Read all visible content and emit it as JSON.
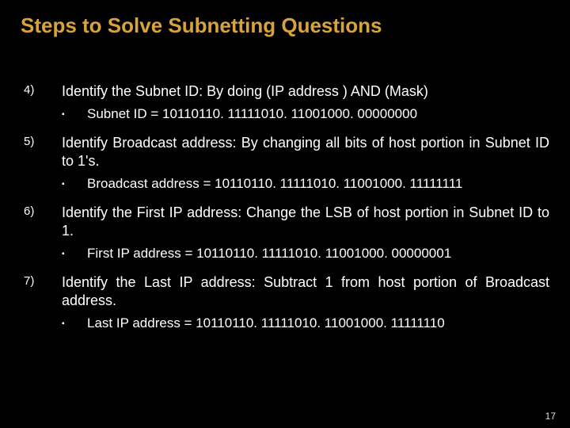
{
  "title": "Steps to Solve Subnetting Questions",
  "steps": [
    {
      "num": "4)",
      "text": "Identify the Subnet ID: By doing (IP address ) AND (Mask)",
      "sub_prefix": "Subnet ID",
      "sub_value": " = 10110110. 11111010. 11001000. 00000000"
    },
    {
      "num": "5)",
      "text": "Identify Broadcast address: By changing all bits of host portion in Subnet ID to 1's.",
      "sub_prefix": "Broadcast address ",
      "sub_value": " = 10110110. 11111010. 11001000. 11111111"
    },
    {
      "num": "6)",
      "text": "Identify the First IP address: Change the LSB of  host portion in Subnet ID to 1.",
      "sub_prefix": "First IP address",
      "sub_value": " = 10110110. 11111010. 11001000. 00000001"
    },
    {
      "num": "7)",
      "text": "Identify the Last IP address: Subtract 1 from host portion of Broadcast address.",
      "sub_prefix": "Last IP address ",
      "sub_value": " = 10110110. 11111010. 11001000. 11111110"
    }
  ],
  "bullet_glyph": "▪",
  "page_number": "17"
}
